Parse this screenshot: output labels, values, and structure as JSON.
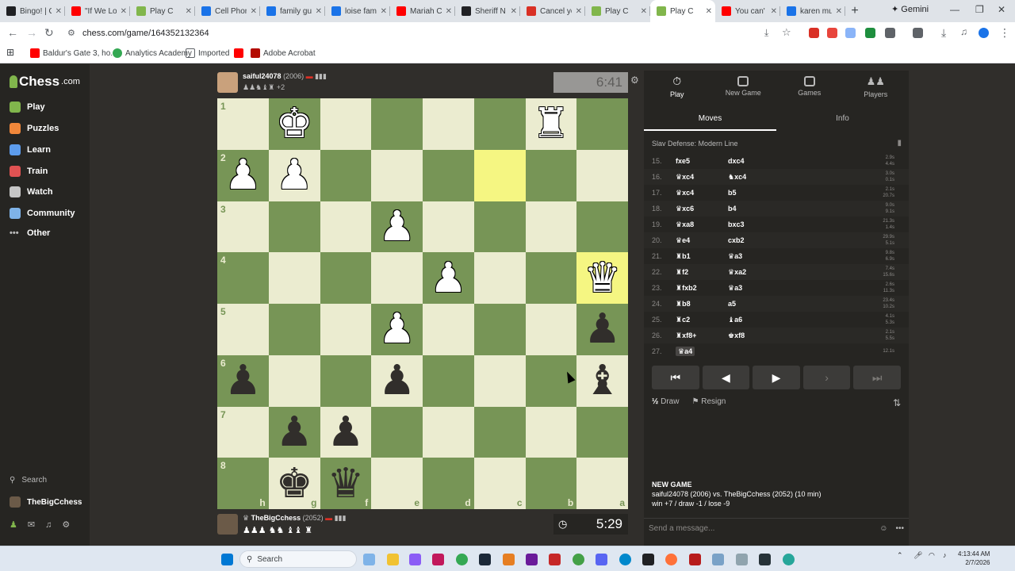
{
  "browser": {
    "tabs": [
      {
        "title": "Bingo! | C",
        "color": "#202124"
      },
      {
        "title": "\"If We Lo",
        "color": "#ff0000"
      },
      {
        "title": "Play C",
        "color": "#81b64c"
      },
      {
        "title": "Cell Phon",
        "color": "#1a73e8"
      },
      {
        "title": "family gu",
        "color": "#1a73e8"
      },
      {
        "title": "loise fam",
        "color": "#1a73e8"
      },
      {
        "title": "Mariah C",
        "color": "#ff0000"
      },
      {
        "title": "Sheriff N",
        "color": "#202124"
      },
      {
        "title": "Cancel yo",
        "color": "#d93025"
      },
      {
        "title": "Play C",
        "color": "#81b64c"
      },
      {
        "title": "Play C",
        "color": "#81b64c",
        "active": true
      },
      {
        "title": "You can'",
        "color": "#ff0000"
      },
      {
        "title": "karen mu",
        "color": "#1a73e8"
      }
    ],
    "new_tab": "+",
    "gemini_label": "Gemini",
    "url": "chess.com/game/164352132364",
    "bookmarks": [
      "Baldur's Gate 3, ho...",
      "Analytics Academy",
      "Imported",
      "Adobe Acrobat"
    ]
  },
  "sidebar": {
    "logo_main": "Chess",
    "logo_suffix": ".com",
    "items": [
      "Play",
      "Puzzles",
      "Learn",
      "Train",
      "Watch",
      "Community",
      "Other"
    ],
    "search": "Search",
    "username": "TheBigCchess"
  },
  "top_player": {
    "name": "saiful24078",
    "rating": "(2006)",
    "captured_extra": "+2",
    "clock": "6:41"
  },
  "bottom_player": {
    "name": "TheBigCchess",
    "rating": "(2052)",
    "clock": "5:29"
  },
  "board": {
    "ranks": [
      "1",
      "2",
      "3",
      "4",
      "5",
      "6",
      "7",
      "8"
    ],
    "files": [
      "h",
      "g",
      "f",
      "e",
      "d",
      "c",
      "b",
      "a"
    ],
    "pieces": [
      {
        "row": 0,
        "col": 1,
        "glyph": "♚",
        "color": "w"
      },
      {
        "row": 0,
        "col": 6,
        "glyph": "♜",
        "color": "w"
      },
      {
        "row": 1,
        "col": 0,
        "glyph": "♟",
        "color": "w"
      },
      {
        "row": 1,
        "col": 1,
        "glyph": "♟",
        "color": "w"
      },
      {
        "row": 2,
        "col": 3,
        "glyph": "♟",
        "color": "w"
      },
      {
        "row": 3,
        "col": 4,
        "glyph": "♟",
        "color": "w"
      },
      {
        "row": 3,
        "col": 7,
        "glyph": "♛",
        "color": "w"
      },
      {
        "row": 4,
        "col": 3,
        "glyph": "♟",
        "color": "w"
      },
      {
        "row": 4,
        "col": 7,
        "glyph": "♟",
        "color": "b"
      },
      {
        "row": 5,
        "col": 0,
        "glyph": "♟",
        "color": "b"
      },
      {
        "row": 5,
        "col": 3,
        "glyph": "♟",
        "color": "b"
      },
      {
        "row": 5,
        "col": 7,
        "glyph": "♝",
        "color": "b"
      },
      {
        "row": 6,
        "col": 1,
        "glyph": "♟",
        "color": "b"
      },
      {
        "row": 6,
        "col": 2,
        "glyph": "♟",
        "color": "b"
      },
      {
        "row": 7,
        "col": 1,
        "glyph": "♚",
        "color": "b"
      },
      {
        "row": 7,
        "col": 2,
        "glyph": "♛",
        "color": "b"
      }
    ],
    "highlights": [
      [
        1,
        5
      ],
      [
        3,
        7
      ]
    ]
  },
  "panel": {
    "tabs": [
      "Play",
      "New Game",
      "Games",
      "Players"
    ],
    "subtabs": [
      "Moves",
      "Info"
    ],
    "opening": "Slav Defense: Modern Line",
    "moves": [
      {
        "n": "15.",
        "w": "fxe5",
        "b": "dxc4",
        "tw": "2.9s",
        "tb": "4.4s"
      },
      {
        "n": "16.",
        "w": "♛xc4",
        "b": "♞xc4",
        "tw": "3.0s",
        "tb": "0.1s"
      },
      {
        "n": "17.",
        "w": "♛xc4",
        "b": "b5",
        "tw": "2.1s",
        "tb": "20.7s"
      },
      {
        "n": "18.",
        "w": "♛xc6",
        "b": "b4",
        "tw": "9.0s",
        "tb": "9.1s"
      },
      {
        "n": "19.",
        "w": "♛xa8",
        "b": "bxc3",
        "tw": "21.3s",
        "tb": "1.4s"
      },
      {
        "n": "20.",
        "w": "♛e4",
        "b": "cxb2",
        "tw": "29.9s",
        "tb": "5.1s"
      },
      {
        "n": "21.",
        "w": "♜b1",
        "b": "♛a3",
        "tw": "9.8s",
        "tb": "6.9s"
      },
      {
        "n": "22.",
        "w": "♜f2",
        "b": "♛xa2",
        "tw": "7.4s",
        "tb": "15.6s"
      },
      {
        "n": "23.",
        "w": "♜fxb2",
        "b": "♛a3",
        "tw": "2.6s",
        "tb": "11.3s"
      },
      {
        "n": "24.",
        "w": "♜b8",
        "b": "a5",
        "tw": "23.4s",
        "tb": "10.2s"
      },
      {
        "n": "25.",
        "w": "♜c2",
        "b": "♝a6",
        "tw": "4.1s",
        "tb": "5.3s"
      },
      {
        "n": "26.",
        "w": "♜xf8+",
        "b": "♚xf8",
        "tw": "2.1s",
        "tb": "5.5s"
      },
      {
        "n": "27.",
        "w": "♛a4",
        "b": "",
        "tw": "12.1s",
        "tb": ""
      }
    ],
    "controls": [
      "⏮",
      "◀",
      "▶",
      "›",
      "⏭"
    ],
    "draw_label": "Draw",
    "draw_icon": "½",
    "resign_label": "Resign",
    "new_game_title": "NEW GAME",
    "new_game_players": "saiful24078 (2006) vs. TheBigCchess (2052) (10 min)",
    "new_game_record": "win +7 / draw -1 / lose -9",
    "chat_placeholder": "Send a message..."
  },
  "taskbar": {
    "search": "Search",
    "time": "4:13:44 AM",
    "date": "2/7/2026"
  },
  "colors": {
    "light_square": "#ebecd0",
    "dark_square": "#779556",
    "highlight": "#f5f682",
    "brand_green": "#81b64c"
  }
}
